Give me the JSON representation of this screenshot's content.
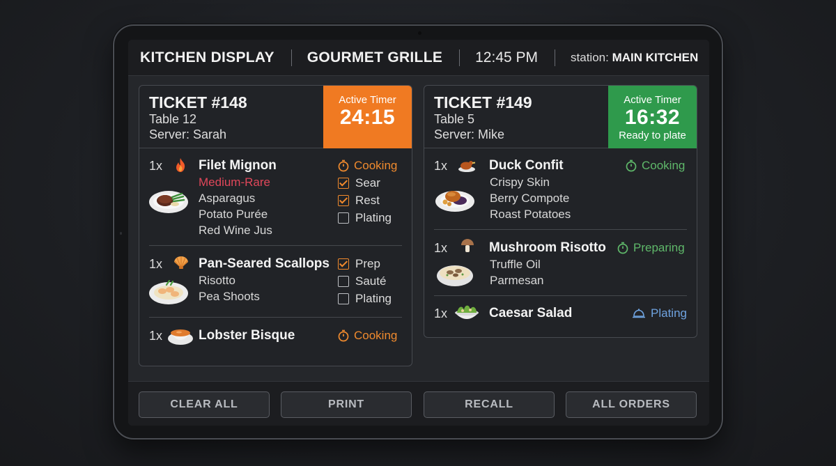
{
  "header": {
    "title": "KITCHEN DISPLAY",
    "restaurant": "GOURMET GRILLE",
    "time": "12:45 PM",
    "station_label": "station:",
    "station_value": "MAIN KITCHEN"
  },
  "colors": {
    "timer_orange": "#f07a22",
    "timer_green": "#2f9a4c",
    "status_orange": "#ef8a2e",
    "status_green": "#5fb86a",
    "status_blue": "#6fa3e0",
    "modifier_red": "#e0475a"
  },
  "tickets": [
    {
      "id": "TICKET #148",
      "table": "Table 12",
      "server": "Server: Sarah",
      "timer_label": "Active Timer",
      "timer_value": "24:15",
      "items": [
        {
          "qty": "1x",
          "icon": "flame-icon",
          "name": "Filet Mignon",
          "modifiers": [
            "Medium-Rare",
            "Asparagus",
            "Potato Purée",
            "Red Wine Jus"
          ],
          "status": "Cooking",
          "checklist": [
            {
              "label": "Sear",
              "checked": true
            },
            {
              "label": "Rest",
              "checked": true
            },
            {
              "label": "Plating",
              "checked": false
            }
          ]
        },
        {
          "qty": "1x",
          "icon": "scallop-shell-icon",
          "name": "Pan-Seared Scallops",
          "modifiers": [
            "Risotto",
            "Pea Shoots"
          ],
          "checklist": [
            {
              "label": "Prep",
              "checked": true
            },
            {
              "label": "Sauté",
              "checked": false
            },
            {
              "label": "Plating",
              "checked": false
            }
          ]
        },
        {
          "qty": "1x",
          "icon": "soup-bowl-icon",
          "name": "Lobster Bisque",
          "status": "Cooking"
        }
      ]
    },
    {
      "id": "TICKET #149",
      "table": "Table 5",
      "server": "Server: Mike",
      "timer_label": "Active Timer",
      "timer_value": "16:32",
      "timer_note": "Ready to plate",
      "items": [
        {
          "qty": "1x",
          "icon": "roast-duck-icon",
          "name": "Duck Confit",
          "modifiers": [
            "Crispy Skin",
            "Berry Compote",
            "Roast Potatoes"
          ],
          "status": "Cooking"
        },
        {
          "qty": "1x",
          "icon": "mushroom-icon",
          "name": "Mushroom Risotto",
          "modifiers": [
            "Truffle Oil",
            "Parmesan"
          ],
          "status": "Preparing"
        },
        {
          "qty": "1x",
          "icon": "salad-bowl-icon",
          "name": "Caesar Salad",
          "status": "Plating"
        }
      ]
    }
  ],
  "footer": {
    "buttons": [
      "CLEAR ALL",
      "PRINT",
      "RECALL",
      "ALL ORDERS"
    ]
  }
}
